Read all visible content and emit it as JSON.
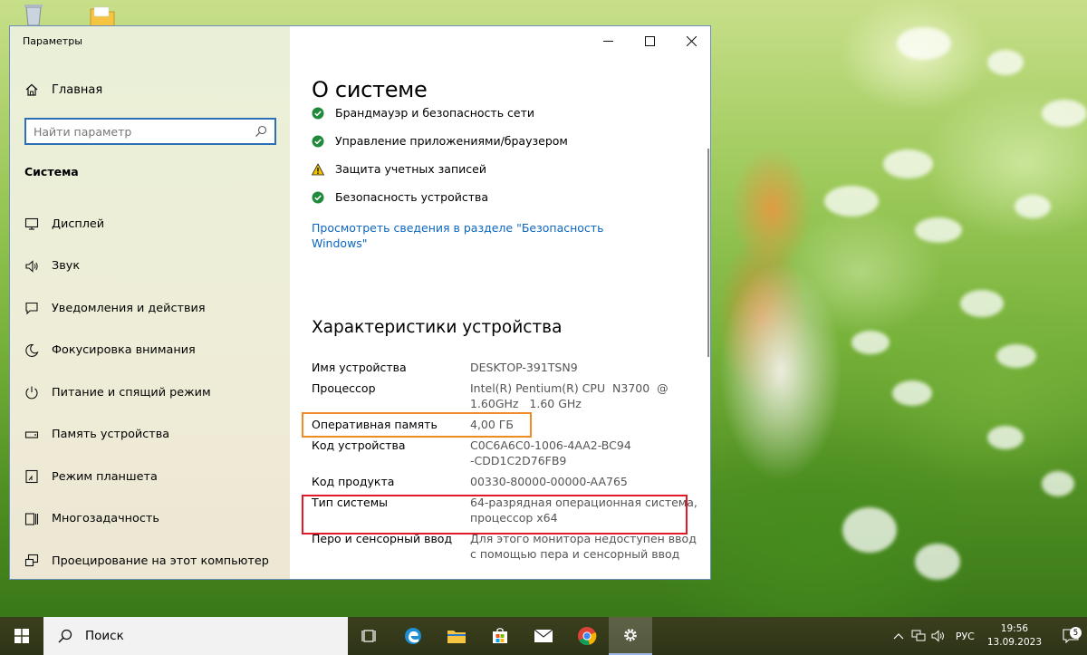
{
  "window": {
    "title": "Параметры"
  },
  "sidebar": {
    "home_label": "Главная",
    "search_placeholder": "Найти параметр",
    "section_title": "Система",
    "items": [
      {
        "label": "Дисплей",
        "icon": "monitor-icon"
      },
      {
        "label": "Звук",
        "icon": "speaker-icon"
      },
      {
        "label": "Уведомления и действия",
        "icon": "notification-icon"
      },
      {
        "label": "Фокусировка внимания",
        "icon": "moon-icon"
      },
      {
        "label": "Питание и спящий режим",
        "icon": "power-icon"
      },
      {
        "label": "Память устройства",
        "icon": "storage-icon"
      },
      {
        "label": "Режим планшета",
        "icon": "tablet-icon"
      },
      {
        "label": "Многозадачность",
        "icon": "multitasking-icon"
      },
      {
        "label": "Проецирование на этот компьютер",
        "icon": "projection-icon"
      }
    ]
  },
  "content": {
    "page_title": "О системе",
    "security_items": [
      {
        "label": "Брандмауэр и безопасность сети",
        "status": "ok"
      },
      {
        "label": "Управление приложениями/браузером",
        "status": "ok"
      },
      {
        "label": "Защита учетных записей",
        "status": "warning"
      },
      {
        "label": "Безопасность устройства",
        "status": "ok"
      }
    ],
    "security_link": "Просмотреть сведения в разделе \"Безопасность Windows\"",
    "specs_title": "Характеристики устройства",
    "specs": [
      {
        "label": "Имя устройства",
        "value": "DESKTOP-391TSN9"
      },
      {
        "label": "Процессор",
        "value": "Intel(R) Pentium(R) CPU  N3700  @ 1.60GHz   1.60 GHz"
      },
      {
        "label": "Оперативная память",
        "value": "4,00 ГБ"
      },
      {
        "label": "Код устройства",
        "value": "C0C6A6C0-1006-4AA2-BC94-CDD1C2D76FB9"
      },
      {
        "label": "Код продукта",
        "value": "00330-80000-00000-AA765"
      },
      {
        "label": "Тип системы",
        "value": "64-разрядная операционная система, процессор x64"
      },
      {
        "label": "Перо и сенсорный ввод",
        "value": "Для этого монитора недоступен ввод с помощью пера и сенсорный ввод"
      }
    ]
  },
  "taskbar": {
    "search_placeholder": "Поиск",
    "language": "РУС",
    "time": "19:56",
    "date": "13.09.2023",
    "notification_count": "5"
  },
  "colors": {
    "accent": "#0b66c2",
    "ok": "#1e8a3a",
    "warning": "#f2c100",
    "highlight_orange": "#f08a24",
    "highlight_red": "#e0192a"
  }
}
